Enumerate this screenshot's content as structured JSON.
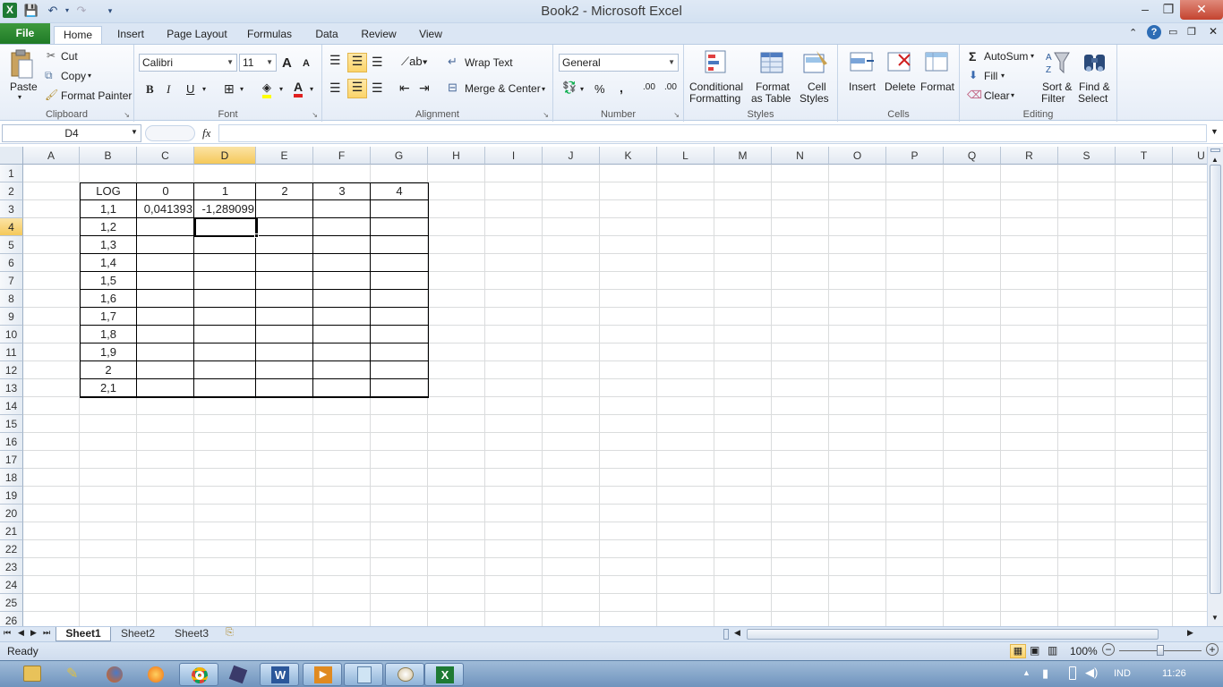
{
  "window": {
    "title": "Book2  -  Microsoft Excel",
    "minimize": "–",
    "restore": "❐",
    "close": "✕"
  },
  "tabs": [
    "File",
    "Home",
    "Insert",
    "Page Layout",
    "Formulas",
    "Data",
    "Review",
    "View"
  ],
  "clipboard": {
    "paste": "Paste",
    "cut": "Cut",
    "copy": "Copy",
    "format_painter": "Format Painter",
    "label": "Clipboard"
  },
  "font": {
    "name": "Calibri",
    "size": "11",
    "bold": "B",
    "italic": "I",
    "underline": "U",
    "grow": "A",
    "shrink": "A",
    "label": "Font"
  },
  "alignment": {
    "wrap": "Wrap Text",
    "merge": "Merge & Center",
    "label": "Alignment"
  },
  "number": {
    "format": "General",
    "percent": "%",
    "comma": ",",
    "inc": ".00",
    "dec": ".00",
    "label": "Number"
  },
  "styles": {
    "cond_line1": "Conditional",
    "cond_line2": "Formatting",
    "table_line1": "Format",
    "table_line2": "as Table",
    "cell_line1": "Cell",
    "cell_line2": "Styles",
    "label": "Styles"
  },
  "cells": {
    "insert": "Insert",
    "delete": "Delete",
    "format": "Format",
    "label": "Cells"
  },
  "editing": {
    "autosum": "AutoSum",
    "fill": "Fill",
    "clear": "Clear",
    "sort_line1": "Sort &",
    "sort_line2": "Filter",
    "find_line1": "Find &",
    "find_line2": "Select",
    "label": "Editing"
  },
  "formula_bar": {
    "name_box": "D4",
    "fx": "fx",
    "value": ""
  },
  "columns": [
    "A",
    "B",
    "C",
    "D",
    "E",
    "F",
    "G",
    "H",
    "I",
    "J",
    "K",
    "L",
    "M",
    "N",
    "O",
    "P",
    "Q",
    "R",
    "S",
    "T",
    "U"
  ],
  "rows": [
    "1",
    "2",
    "3",
    "4",
    "5",
    "6",
    "7",
    "8",
    "9",
    "10",
    "11",
    "12",
    "13",
    "14",
    "15",
    "16",
    "17",
    "18",
    "19",
    "20",
    "21",
    "22",
    "23",
    "24",
    "25",
    "26"
  ],
  "selected_cell": "D4",
  "table": {
    "header": [
      "LOG",
      "0",
      "1",
      "2",
      "3",
      "4"
    ],
    "row_labels": [
      "1,1",
      "1,2",
      "1,3",
      "1,4",
      "1,5",
      "1,6",
      "1,7",
      "1,8",
      "1,9",
      "2",
      "2,1"
    ],
    "C3": "0,041393",
    "D3": "-1,289099"
  },
  "sheet_tabs": [
    "Sheet1",
    "Sheet2",
    "Sheet3"
  ],
  "status": {
    "ready": "Ready",
    "zoom": "100%"
  },
  "taskbar": {
    "lang": "IND",
    "time": "11:26"
  }
}
